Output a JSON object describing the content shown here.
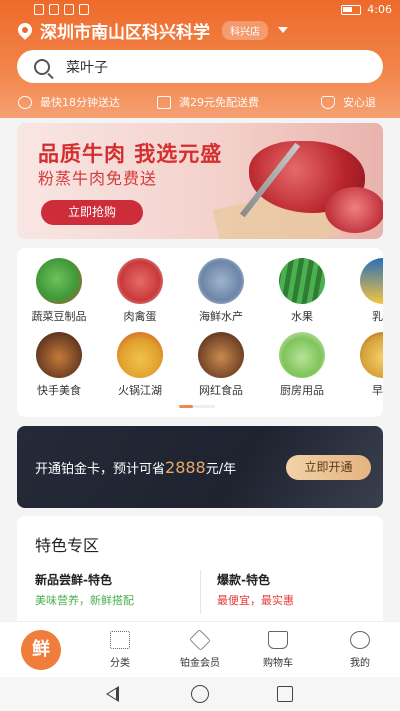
{
  "status_bar": {
    "time": "4:06"
  },
  "header": {
    "location": "深圳市南山区科兴科学",
    "store_badge": "科兴店",
    "search_placeholder": "菜叶子",
    "perks": [
      {
        "icon": "clock-icon",
        "text": "最快18分钟送达"
      },
      {
        "icon": "cart-icon",
        "text": "满29元免配送费"
      },
      {
        "icon": "shield-icon",
        "text": "安心退"
      }
    ]
  },
  "banner": {
    "title": "品质牛肉 我选元盛",
    "subtitle": "粉蒸牛肉免费送",
    "button": "立即抢购"
  },
  "categories": [
    {
      "label": "蔬菜豆制品",
      "color": "#3f9a3a"
    },
    {
      "label": "肉禽蛋",
      "color": "#c83a3a"
    },
    {
      "label": "海鲜水产",
      "color": "#6c86a8"
    },
    {
      "label": "水果",
      "color": "#2e7d32"
    },
    {
      "label": "乳品",
      "color": "#2a6fb5"
    },
    {
      "label": "快手美食",
      "color": "#6b3d22"
    },
    {
      "label": "火锅江湖",
      "color": "#e0a12c"
    },
    {
      "label": "网红食品",
      "color": "#7a4a2a"
    },
    {
      "label": "厨房用品",
      "color": "#7fc45a"
    },
    {
      "label": "早餐",
      "color": "#d8a13a"
    }
  ],
  "member": {
    "text_before": "开通铂金卡，预计可省",
    "amount": "2888",
    "text_after": "元/年",
    "button": "立即开通"
  },
  "featured": {
    "title": "特色专区",
    "items": [
      {
        "name": "新品尝鲜-特色",
        "desc": "美味营养，新鲜搭配",
        "desc_color": "#4caf50"
      },
      {
        "name": "爆款-特色",
        "desc": "最便宜，最实惠",
        "desc_color": "#e53935"
      }
    ]
  },
  "tabs": [
    {
      "label": "",
      "icon": "fresh-logo-icon",
      "glyph": "鲜"
    },
    {
      "label": "分类",
      "icon": "grid-icon"
    },
    {
      "label": "铂金会员",
      "icon": "diamond-icon"
    },
    {
      "label": "购物车",
      "icon": "cart-icon"
    },
    {
      "label": "我的",
      "icon": "face-icon"
    }
  ],
  "colors": {
    "brand": "#ee6a2a",
    "accent": "#cd2c39",
    "gold": "#e8a86a"
  }
}
